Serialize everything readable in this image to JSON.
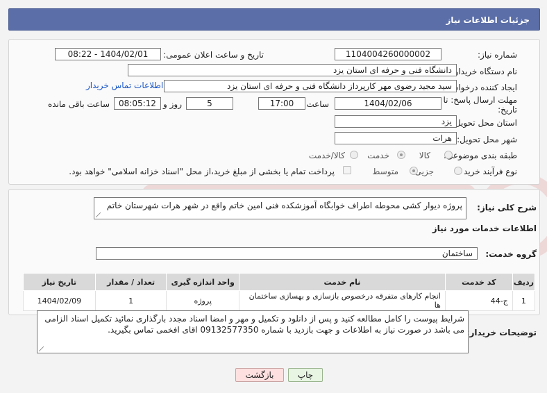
{
  "header": {
    "title": "جزئیات اطلاعات نیاز"
  },
  "form": {
    "need_number_label": "شماره نیاز:",
    "need_number": "1104004260000002",
    "announce_label": "تاریخ و ساعت اعلان عمومی:",
    "announce_value": "1404/02/01 - 08:22",
    "buyer_org_label": "نام دستگاه خریدار:",
    "buyer_org": "دانشگاه فنی و حرفه ای استان یزد",
    "creator_label": "ایجاد کننده درخواست:",
    "creator": "سید مجید رضوی مهر کارپرداز دانشگاه فنی و حرفه ای استان یزد",
    "contact_link": "اطلاعات تماس خریدار",
    "deadline_label_1": "مهلت ارسال پاسخ: تا",
    "deadline_label_2": "تاریخ:",
    "deadline_date": "1404/02/06",
    "time_label": "ساعت",
    "deadline_time": "17:00",
    "days_value": "5",
    "days_label": "روز و",
    "remaining_time": "08:05:12",
    "remaining_label": "ساعت باقی مانده",
    "province_label": "استان محل تحویل:",
    "province": "یزد",
    "city_label": "شهر محل تحویل:",
    "city": "هرات",
    "category_label": "طبقه بندی موضوعی:",
    "category_options": [
      "کالا",
      "خدمت",
      "کالا/خدمت"
    ],
    "process_label": "نوع فرآیند خرید :",
    "process_options": [
      "جزیی",
      "متوسط"
    ],
    "payment_text": "پرداخت تمام یا بخشی از مبلغ خرید،از محل \"اسناد خزانه اسلامی\" خواهد بود."
  },
  "summary": {
    "label": "شرح کلی نیاز:",
    "text": "پروژه دیوار کشی محوطه اطراف خوابگاه آموزشکده فنی امین خاتم واقع در شهر هرات شهرستان خاتم"
  },
  "services": {
    "section_title": "اطلاعات خدمات مورد نیاز",
    "group_label": "گروه خدمت:",
    "group_value": "ساختمان",
    "columns": [
      "ردیف",
      "کد خدمت",
      "نام خدمت",
      "واحد اندازه گیری",
      "تعداد / مقدار",
      "تاریخ نیاز"
    ],
    "rows": [
      [
        "1",
        "ج-44",
        "انجام کارهای متفرقه درخصوص بازسازی و بهسازی ساختمان ها",
        "پروژه",
        "1",
        "1404/02/09"
      ]
    ]
  },
  "notes": {
    "label": "توضیحات خریدار:",
    "text": "شرایط پیوست را کامل مطالعه کنید و پس از دانلود و تکمیل و مهر و امضا اسناد مجدد بارگذاری نمائید تکمیل اسناد الزامی می باشد در صورت نیاز به اطلاعات و جهت بازدید با شماره   09132577350 اقای افخمی تماس بگیرید."
  },
  "buttons": {
    "print": "چاپ",
    "back": "بازگشت"
  },
  "colors": {
    "header": "#5b6ea8",
    "link": "#1a56c7",
    "back_btn": "#ffe0e0",
    "print_btn": "#e8f5e3"
  }
}
